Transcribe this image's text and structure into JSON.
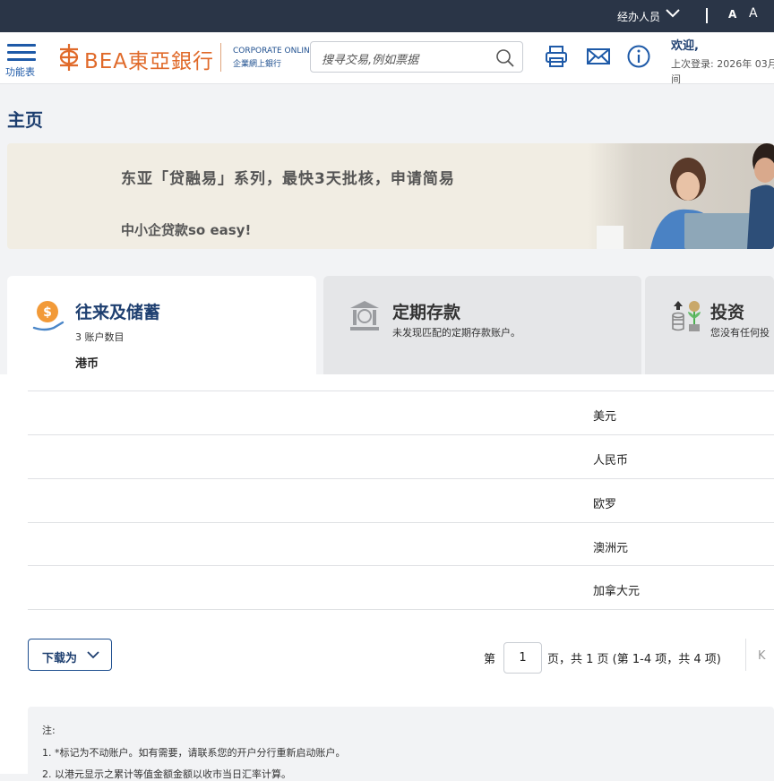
{
  "topbar": {
    "role_label": "经办人员",
    "font_small": "A",
    "font_large": "A"
  },
  "header": {
    "menu_label": "功能表",
    "logo_text": "BEA東亞銀行",
    "corporate_line1": "CORPORATE ONLINE",
    "corporate_line2": "企業網上銀行",
    "search_placeholder": "搜寻交易,例如票据",
    "welcome": "欢迎,",
    "last_login": "上次登录: 2026年 03月",
    "last_login_cont": "间"
  },
  "page": {
    "title": "主页"
  },
  "banner": {
    "line1": "东亚「贷融易」系列，最快3天批核，申请简易",
    "line2": "中小企贷款so easy!"
  },
  "cards": [
    {
      "title": "往来及储蓄",
      "subtitle": "3 账户数目",
      "currency": "港币",
      "icon": "money-hand-icon"
    },
    {
      "title": "定期存款",
      "subtitle": "未发现匹配的定期存款账户。",
      "icon": "bank-building-icon"
    },
    {
      "title": "投资",
      "subtitle": "您没有任何投",
      "icon": "investment-growth-icon"
    }
  ],
  "currency_rows": [
    "美元",
    "人民币",
    "欧罗",
    "澳洲元",
    "加拿大元"
  ],
  "download": {
    "label": "下载为"
  },
  "pagination": {
    "prefix": "第",
    "page": "1",
    "suffix": "页，共 1 页  (第 1-4 项，共 4 项)",
    "first": "K"
  },
  "notes": {
    "title": "注:",
    "items": [
      "1. *标记为不动账户。如有需要，请联系您的开户分行重新启动账户。",
      "2. 以港元显示之累计等值金额金额以收市当日汇率计算。"
    ]
  },
  "colors": {
    "topbar": "#2a3547",
    "brand_blue": "#1e5aa8",
    "logo_orange": "#e06a2a",
    "banner_bg": "#f1ede3"
  }
}
